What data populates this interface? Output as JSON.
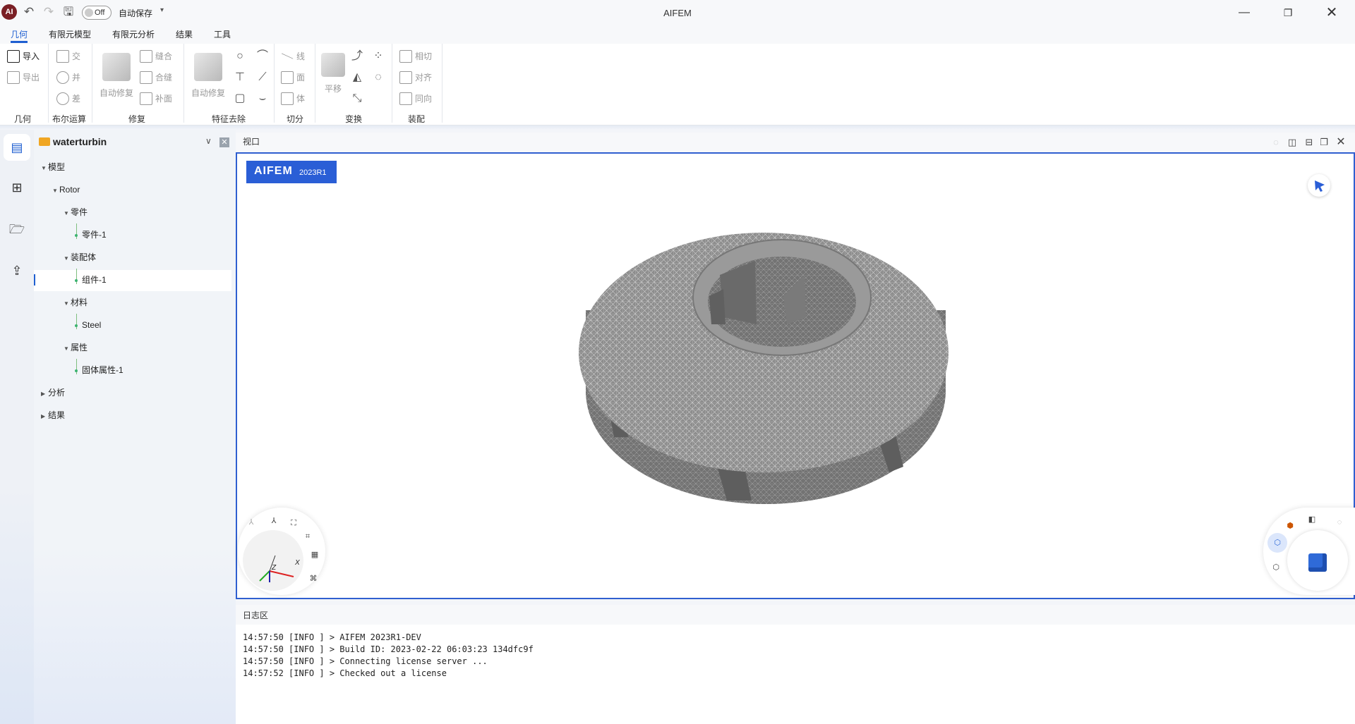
{
  "app": {
    "title": "AIFEM",
    "logo_text": "AI",
    "autosave_state": "Off",
    "autosave_label": "自动保存"
  },
  "menu": {
    "tabs": [
      "几何",
      "有限元模型",
      "有限元分析",
      "结果",
      "工具"
    ],
    "active": 0
  },
  "ribbon": {
    "import": "导入",
    "export": "导出",
    "geometry_group": "几何",
    "intersect": "交",
    "union": "并",
    "subtract": "差",
    "boolean_group": "布尔运算",
    "auto_repair": "自动修复",
    "stitch": "缝合",
    "merge_seam": "合缝",
    "patch": "补面",
    "repair_group": "修复",
    "feature_auto_repair": "自动修复",
    "feature_group": "特征去除",
    "split_line": "线",
    "split_face": "面",
    "split_body": "体",
    "split_group": "切分",
    "translate": "平移",
    "transform_group": "变换",
    "tangent": "相切",
    "align": "对齐",
    "same_direction": "同向",
    "assembly_group": "装配"
  },
  "tree": {
    "project": "waterturbin",
    "nodes": {
      "model": "模型",
      "rotor": "Rotor",
      "parts": "零件",
      "part1": "零件-1",
      "assembly": "装配体",
      "component1": "组件-1",
      "materials": "材料",
      "steel": "Steel",
      "properties": "属性",
      "solid_prop1": "固体属性-1",
      "analysis": "分析",
      "results": "结果"
    }
  },
  "viewport": {
    "title": "视口",
    "brand": "AIFEM",
    "version": "2023R1",
    "axis_x": "X",
    "axis_z": "Z"
  },
  "log": {
    "title": "日志区",
    "lines": [
      "14:57:50 [INFO ] > AIFEM 2023R1-DEV",
      "14:57:50 [INFO ] > Build ID: 2023-02-22 06:03:23 134dfc9f",
      "14:57:50 [INFO ] > Connecting license server ...",
      "14:57:52 [INFO ] > Checked out a license"
    ]
  },
  "colors": {
    "accent": "#1f5fd1",
    "brand_badge": "#2a5ed6",
    "mesh": "#8a8a8a",
    "folder": "#f0a623"
  }
}
